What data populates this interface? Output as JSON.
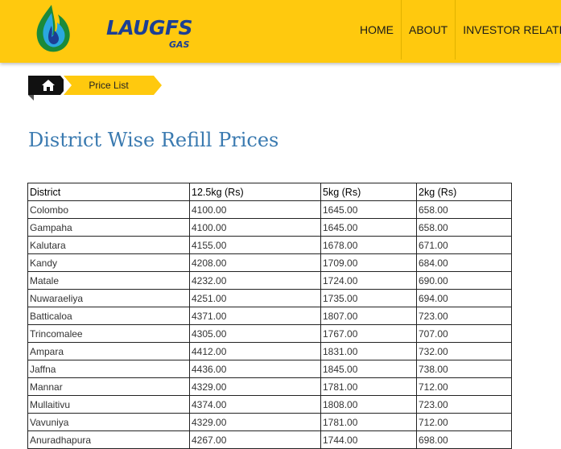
{
  "header": {
    "logo_text": "LAUGFS",
    "logo_sub": "GAS",
    "nav": [
      "HOME",
      "ABOUT",
      "INVESTOR RELATIONS"
    ]
  },
  "breadcrumb": {
    "current": "Price List"
  },
  "page": {
    "title": "District Wise Refill Prices"
  },
  "table": {
    "headers": [
      "District",
      "12.5kg (Rs)",
      "5kg (Rs)",
      "2kg (Rs)"
    ],
    "rows": [
      [
        "Colombo",
        "4100.00",
        "1645.00",
        "658.00"
      ],
      [
        "Gampaha",
        "4100.00",
        "1645.00",
        "658.00"
      ],
      [
        "Kalutara",
        "4155.00",
        "1678.00",
        "671.00"
      ],
      [
        "Kandy",
        "4208.00",
        "1709.00",
        "684.00"
      ],
      [
        "Matale",
        "4232.00",
        "1724.00",
        "690.00"
      ],
      [
        "Nuwaraeliya",
        "4251.00",
        "1735.00",
        "694.00"
      ],
      [
        "Batticaloa",
        "4371.00",
        "1807.00",
        "723.00"
      ],
      [
        "Trincomalee",
        "4305.00",
        "1767.00",
        "707.00"
      ],
      [
        "Ampara",
        "4412.00",
        "1831.00",
        "732.00"
      ],
      [
        "Jaffna",
        "4436.00",
        "1845.00",
        "738.00"
      ],
      [
        "Mannar",
        "4329.00",
        "1781.00",
        "712.00"
      ],
      [
        "Mullaitivu",
        "4374.00",
        "1808.00",
        "723.00"
      ],
      [
        "Vavuniya",
        "4329.00",
        "1781.00",
        "712.00"
      ],
      [
        "Anuradhapura",
        "4267.00",
        "1744.00",
        "698.00"
      ]
    ]
  }
}
